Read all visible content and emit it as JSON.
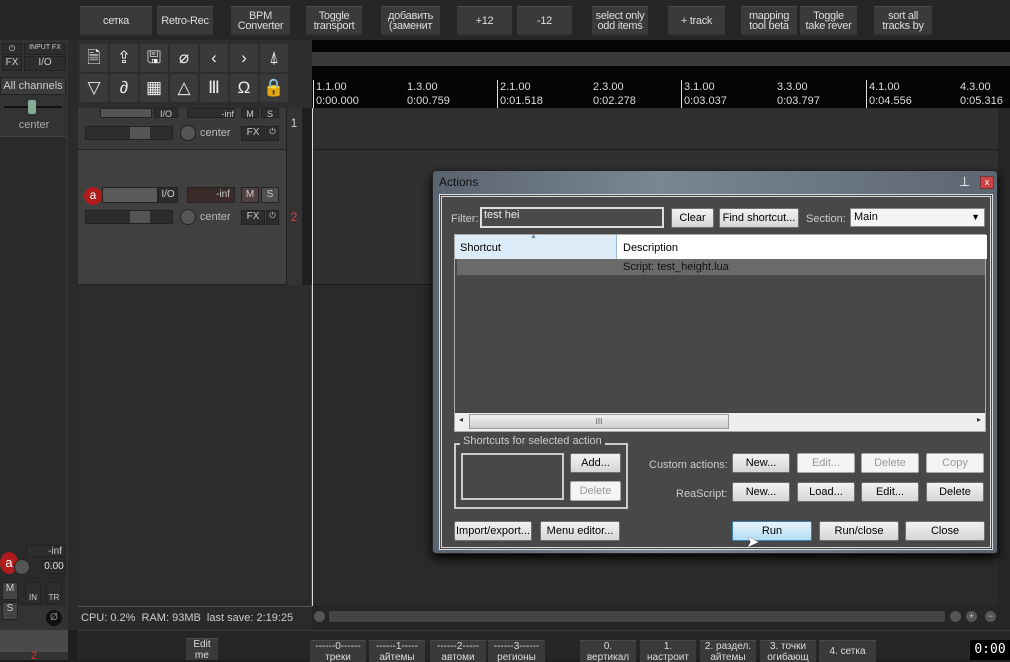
{
  "toolbar": {
    "buttons": [
      "сетка",
      "Retro-Rec",
      "BPM\nConverter",
      "Toggle\ntransport",
      "добавить\n(заменит",
      "+12",
      "-12",
      "select only\nodd items",
      "+ track",
      "mapping\ntool beta",
      "Toggle\ntake rever",
      "sort all\ntracks by"
    ]
  },
  "master": {
    "fx": "FX",
    "input_fx": "INPUT FX",
    "io": "I/O",
    "channels": "All channels",
    "pan": "center",
    "vol": "-inf",
    "pan_val": "0.00",
    "m": "M",
    "s": "S",
    "in": "IN",
    "tr": "TR",
    "track_num": "2"
  },
  "tool_icons": [
    "new-project",
    "open-project",
    "save-project",
    "attach",
    "back",
    "forward",
    "metronome",
    "filter",
    "link",
    "grid",
    "envelope",
    "ripple",
    "snap",
    "lock"
  ],
  "ruler": {
    "marks": [
      {
        "bar": "1.1.00",
        "time": "0:00.000"
      },
      {
        "bar": "1.3.00",
        "time": "0:00.759"
      },
      {
        "bar": "2.1.00",
        "time": "0:01.518"
      },
      {
        "bar": "2.3.00",
        "time": "0:02.278"
      },
      {
        "bar": "3.1.00",
        "time": "0:03.037"
      },
      {
        "bar": "3.3.00",
        "time": "0:03.797"
      },
      {
        "bar": "4.1.00",
        "time": "0:04.556"
      },
      {
        "bar": "4.3.00",
        "time": "0:05.316"
      }
    ]
  },
  "tracks": [
    {
      "num": "1",
      "io": "I/O",
      "vol": "-inf",
      "m": "M",
      "s": "S",
      "fx": "FX",
      "pan": "center"
    },
    {
      "num": "2",
      "io": "I/O",
      "vol": "-inf",
      "m": "M",
      "s": "S",
      "fx": "FX",
      "pan": "center"
    }
  ],
  "dialog": {
    "title": "Actions",
    "filter_label": "Filter:",
    "filter_value": "test hei",
    "clear": "Clear",
    "find_shortcut": "Find shortcut...",
    "section_label": "Section:",
    "section_value": "Main",
    "columns": [
      "Shortcut",
      "Description"
    ],
    "rows": [
      {
        "shortcut": "",
        "description": "Script: test_height.lua"
      }
    ],
    "shortcuts_group": "Shortcuts for selected action",
    "add": "Add...",
    "delete": "Delete",
    "custom_label": "Custom actions:",
    "custom_buttons": [
      "New...",
      "Edit...",
      "Delete",
      "Copy"
    ],
    "reascript_label": "ReaScript:",
    "reascript_buttons": [
      "New...",
      "Load...",
      "Edit...",
      "Delete"
    ],
    "import_export": "Import/export...",
    "menu_editor": "Menu editor...",
    "run": "Run",
    "run_close": "Run/close",
    "close": "Close"
  },
  "status": "CPU: 0.2%  RAM: 93MB  last save: 2:19:25",
  "bottom": {
    "buttons": [
      "Edit\nme",
      "------0------\nтреки",
      "------1-----\nайтемы",
      "------2-----\nавтоми",
      "------3------\nрегионы",
      "0.\nвертикал",
      "1.\nнастроит",
      "2. раздел.\nайтемы",
      "3. точки\nогибающ",
      "4. сетка"
    ],
    "time": "0:00"
  }
}
